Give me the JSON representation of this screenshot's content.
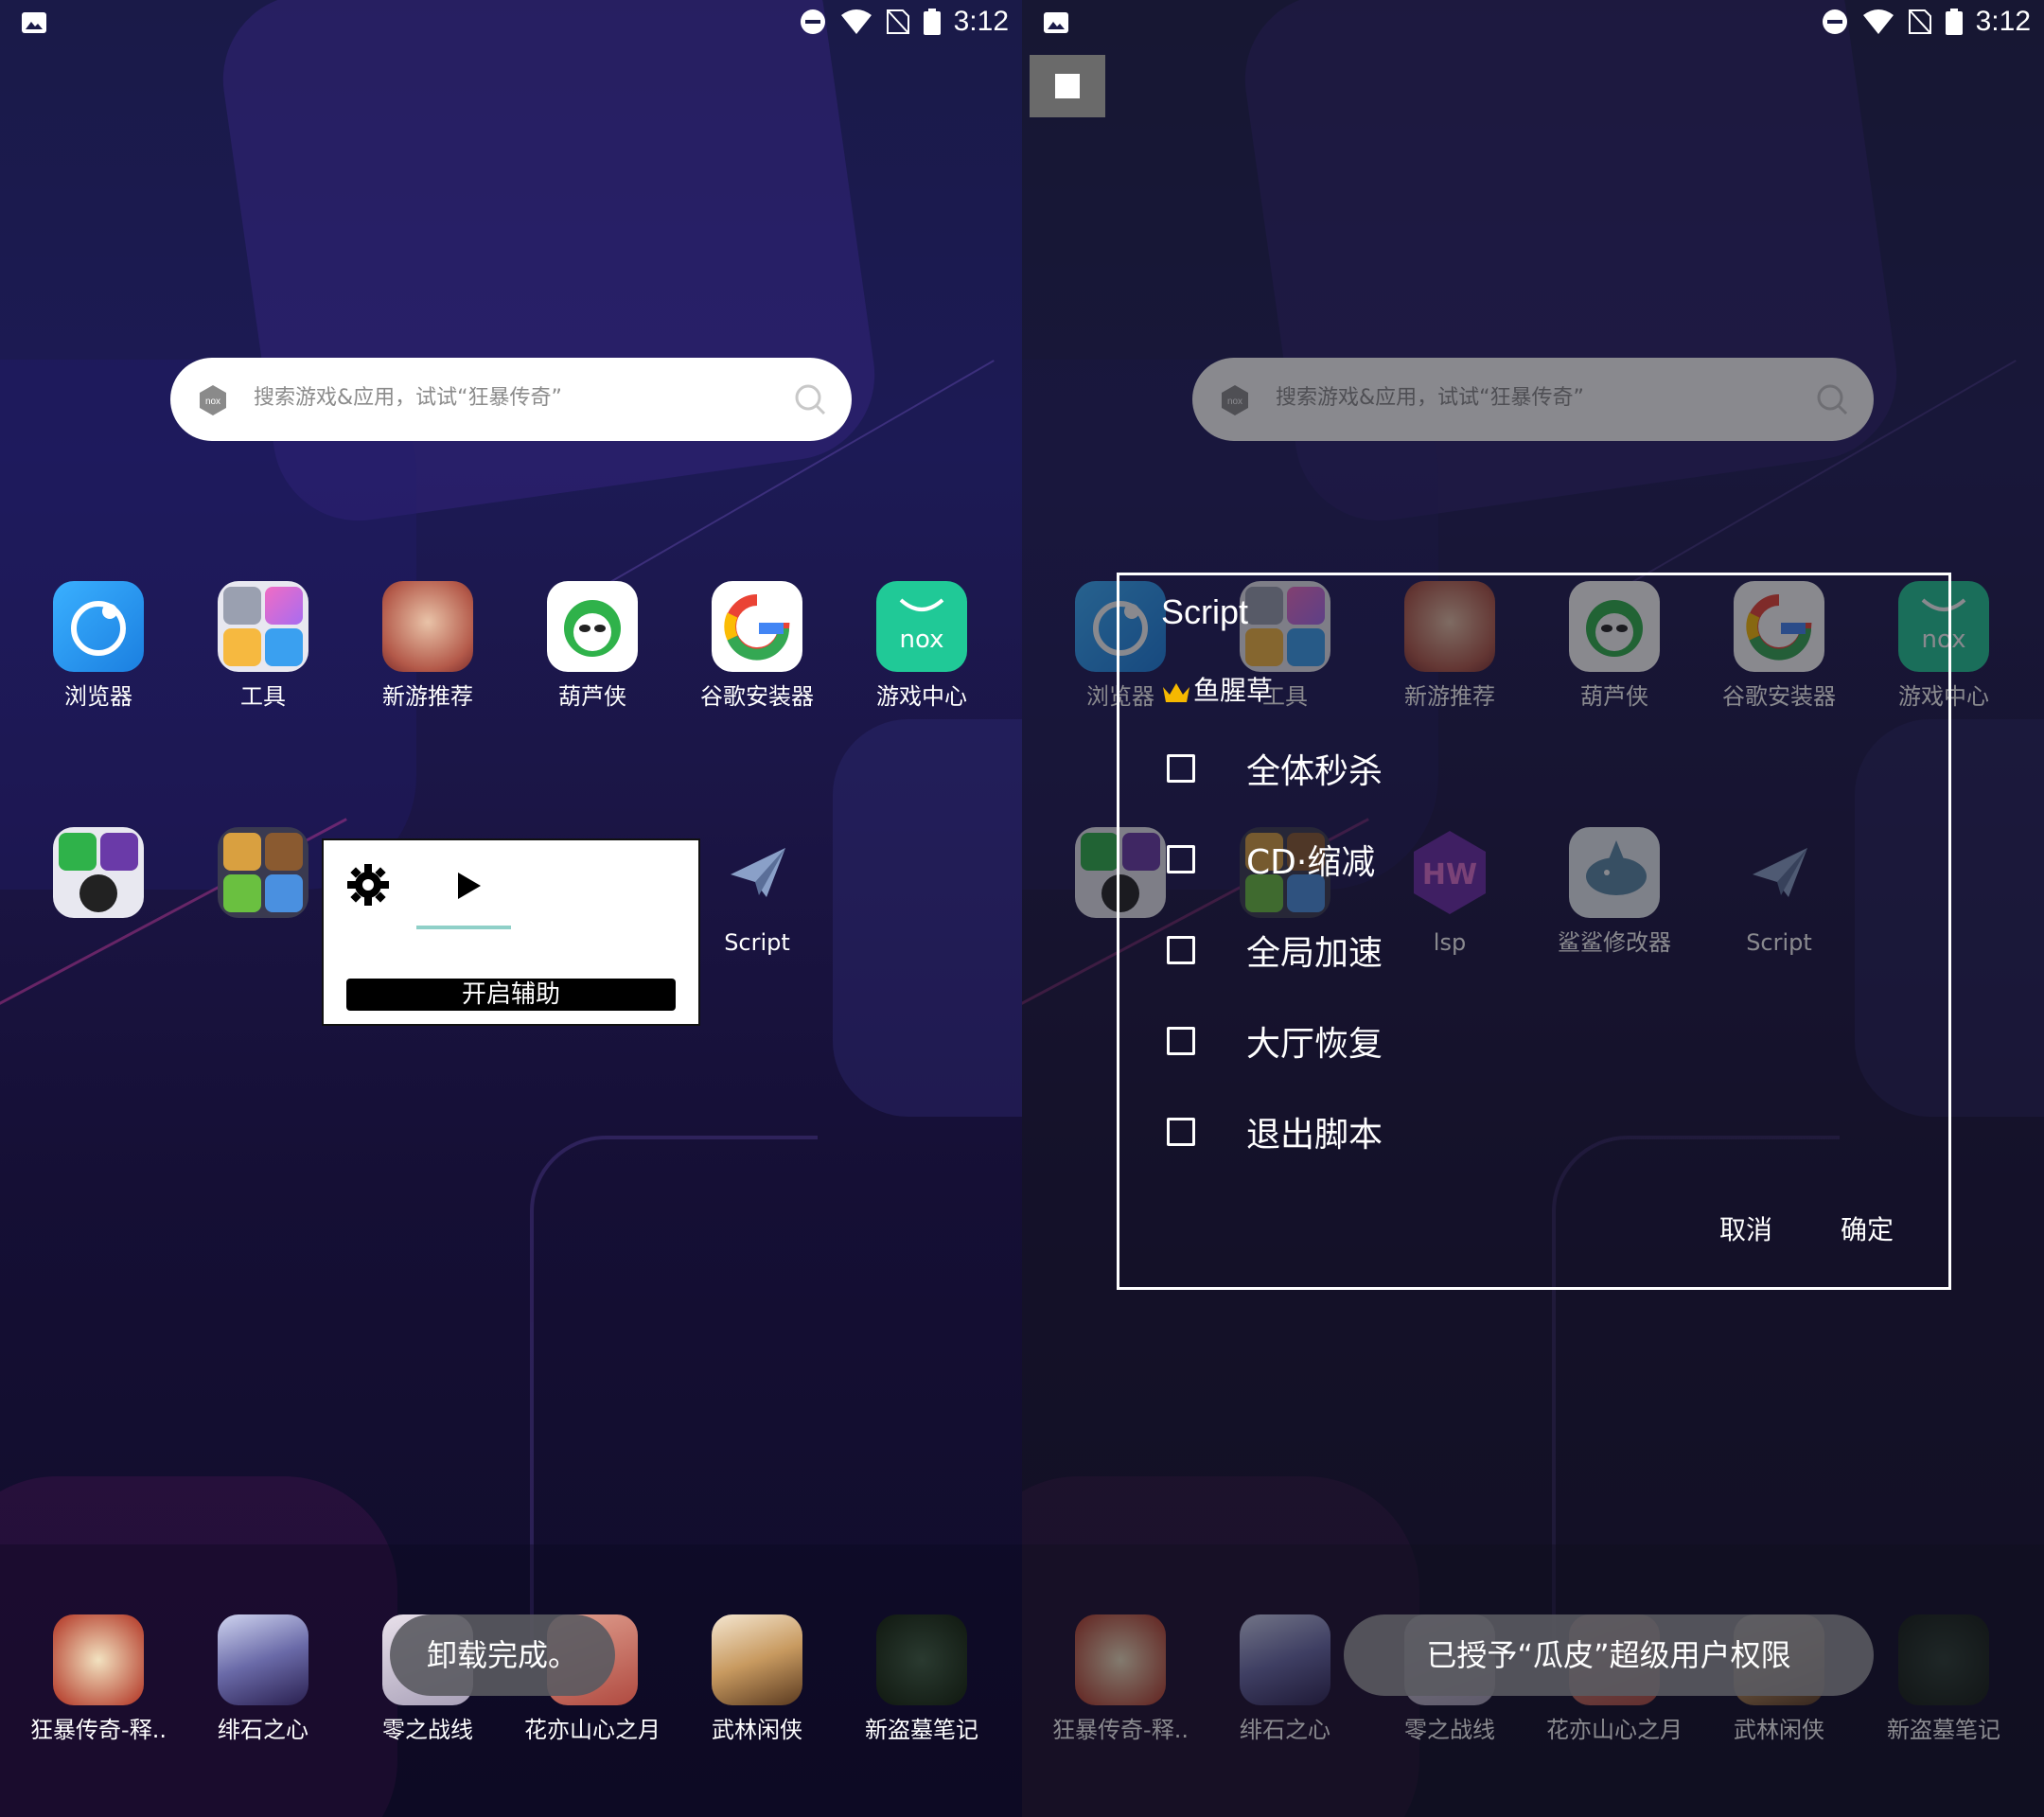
{
  "status": {
    "time": "3:12"
  },
  "search": {
    "placeholder": "搜索游戏&应用，试试“狂暴传奇”"
  },
  "apps_row1": [
    {
      "label": "浏览器",
      "icon": "browser-icon"
    },
    {
      "label": "工具",
      "icon": "tools-folder-icon"
    },
    {
      "label": "新游推荐",
      "icon": "new-games-icon"
    },
    {
      "label": "葫芦侠",
      "icon": "huluxia-icon"
    },
    {
      "label": "谷歌安装器",
      "icon": "google-installer-icon"
    },
    {
      "label": "游戏中心",
      "icon": "game-center-icon"
    }
  ],
  "apps_row2_left": [
    {
      "label": "",
      "icon": "app-folder-icon"
    },
    {
      "label": "",
      "icon": "games-folder-icon"
    },
    {
      "label": "Script",
      "icon": "script-paper-plane-icon"
    }
  ],
  "apps_row2_right": [
    {
      "label": "",
      "icon": "app-folder-icon"
    },
    {
      "label": "",
      "icon": "games-folder-icon"
    },
    {
      "label": "lsp",
      "icon": "hw-icon"
    },
    {
      "label": "鲨鲨修改器",
      "icon": "shark-editor-icon"
    },
    {
      "label": "Script",
      "icon": "script-paper-plane-icon"
    }
  ],
  "dock": [
    {
      "label": "狂暴传奇-释..",
      "icon": "kuangbao-icon"
    },
    {
      "label": "绯石之心",
      "icon": "feishi-icon"
    },
    {
      "label": "零之战线",
      "icon": "lingzhi-icon"
    },
    {
      "label": "花亦山心之月",
      "icon": "huayishan-icon"
    },
    {
      "label": "武林闲侠",
      "icon": "wulin-icon"
    },
    {
      "label": "新盗墓笔记",
      "icon": "daomu-icon"
    }
  ],
  "popup": {
    "button": "开启辅助"
  },
  "toast_left": "卸载完成。",
  "toast_right": "已授予“瓜皮”超级用户权限",
  "dialog": {
    "title": "Script",
    "subtitle": "鱼腥草",
    "options": [
      "全体秒杀",
      "CD·缩减",
      "全局加速",
      "大厅恢复",
      "退出脚本"
    ],
    "cancel": "取消",
    "ok": "确定"
  }
}
